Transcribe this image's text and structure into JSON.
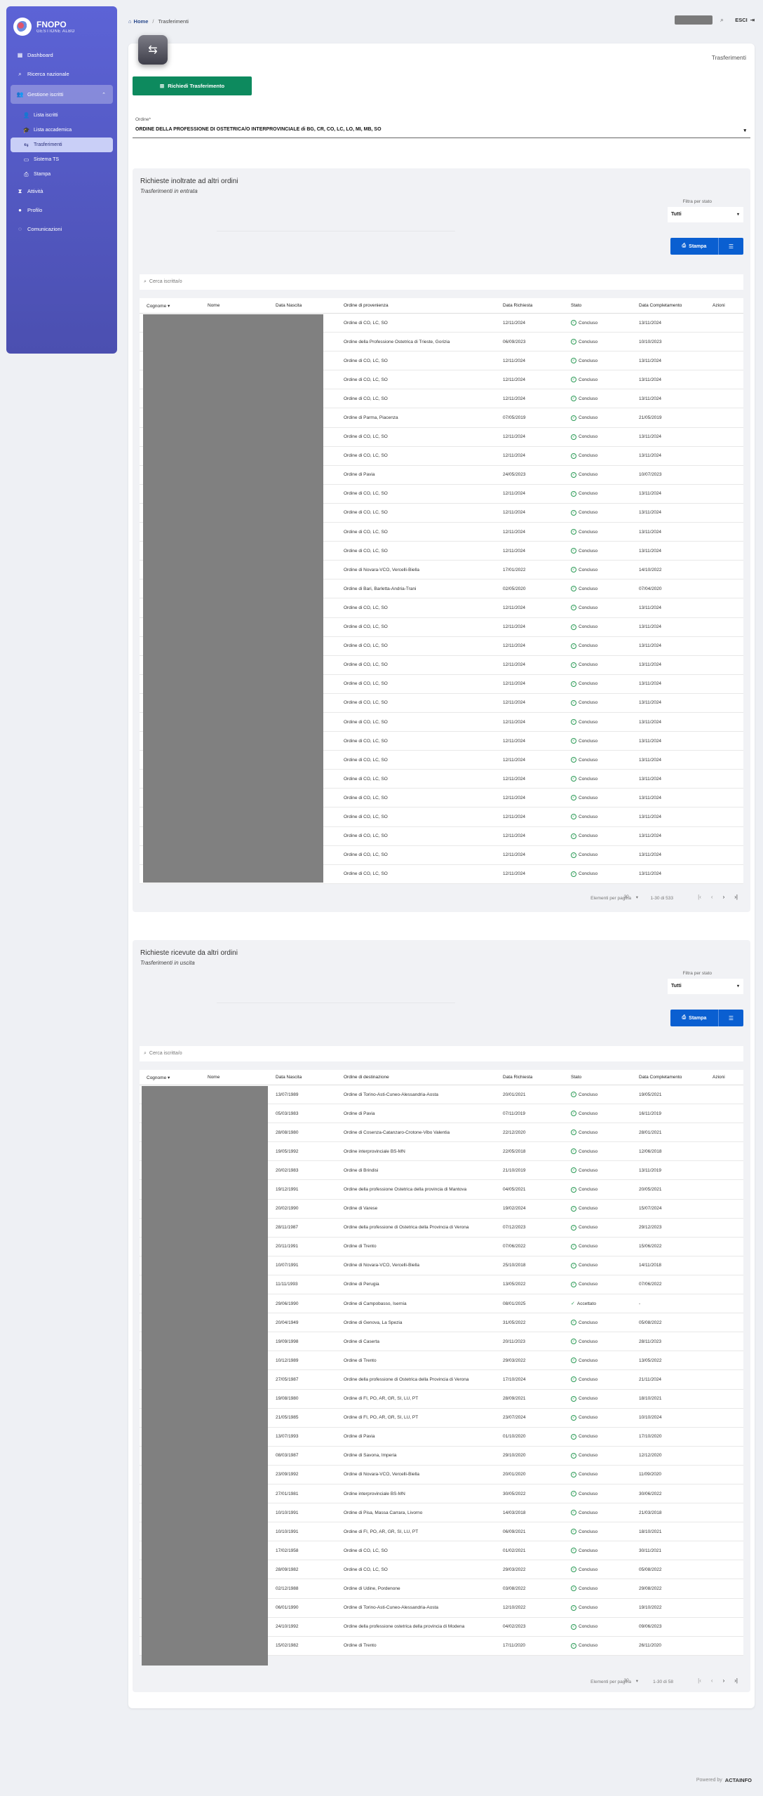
{
  "brand": {
    "title": "FNOPO",
    "subtitle": "GESTIONE ALBO"
  },
  "nav": {
    "dashboard": "Dashboard",
    "ricerca": "Ricerca nazionale",
    "gestione": "Gestione iscritti",
    "sub": [
      "Lista iscritti",
      "Lista accademica",
      "Trasferimenti",
      "Sistema TS",
      "Stampa"
    ],
    "attivita": "Attività",
    "profilo": "Profilo",
    "comunicazioni": "Comunicazioni"
  },
  "breadcrumb": {
    "home": "Home",
    "current": "Trasferimenti"
  },
  "header": {
    "logout": "ESCI"
  },
  "page": {
    "title": "Trasferimenti",
    "request_button": "Richiedi Trasferimento",
    "ordine_label": "Ordine*",
    "ordine_value": "ORDINE DELLA PROFESSIONE DI OSTETRICA/O INTERPROVINCIALE di BG, CR, CO, LC, LO, MI, MB, SO"
  },
  "columns_in": [
    "Cognome",
    "Nome",
    "Data Nascita",
    "Ordine di provenienza",
    "Data Richiesta",
    "Stato",
    "Data Completamento",
    "Azioni"
  ],
  "columns_out": [
    "Cognome",
    "Nome",
    "Data Nascita",
    "Ordine di destinazione",
    "Data Richiesta",
    "Stato",
    "Data Completamento",
    "Azioni"
  ],
  "section_in": {
    "title": "Richieste inoltrate ad altri ordini",
    "subtitle": "Trasferimenti in entrata",
    "filter_label": "Filtra per stato",
    "filter_value": "Tutti",
    "print": "Stampa",
    "search_placeholder": "Cerca iscritta/o",
    "per_page_label": "Elementi per pagina",
    "per_page": "30",
    "range": "1-30 di 533",
    "rows": [
      [
        "",
        "",
        "",
        "Ordine di CO, LC, SO",
        "12/11/2024",
        "Concluso",
        "13/11/2024"
      ],
      [
        "",
        "",
        "",
        "Ordine della Professione Ostetrica di Trieste, Gorizia",
        "06/09/2023",
        "Concluso",
        "10/10/2023"
      ],
      [
        "",
        "",
        "",
        "Ordine di CO, LC, SO",
        "12/11/2024",
        "Concluso",
        "13/11/2024"
      ],
      [
        "",
        "",
        "",
        "Ordine di CO, LC, SO",
        "12/11/2024",
        "Concluso",
        "13/11/2024"
      ],
      [
        "",
        "",
        "",
        "Ordine di CO, LC, SO",
        "12/11/2024",
        "Concluso",
        "13/11/2024"
      ],
      [
        "",
        "",
        "",
        "Ordine di Parma, Piacenza",
        "07/05/2019",
        "Concluso",
        "21/05/2019"
      ],
      [
        "",
        "",
        "",
        "Ordine di CO, LC, SO",
        "12/11/2024",
        "Concluso",
        "13/11/2024"
      ],
      [
        "",
        "",
        "",
        "Ordine di CO, LC, SO",
        "12/11/2024",
        "Concluso",
        "13/11/2024"
      ],
      [
        "",
        "",
        "",
        "Ordine di Pavia",
        "24/05/2023",
        "Concluso",
        "10/07/2023"
      ],
      [
        "",
        "",
        "",
        "Ordine di CO, LC, SO",
        "12/11/2024",
        "Concluso",
        "13/11/2024"
      ],
      [
        "",
        "",
        "",
        "Ordine di CO, LC, SO",
        "12/11/2024",
        "Concluso",
        "13/11/2024"
      ],
      [
        "",
        "",
        "",
        "Ordine di CO, LC, SO",
        "12/11/2024",
        "Concluso",
        "13/11/2024"
      ],
      [
        "",
        "",
        "",
        "Ordine di CO, LC, SO",
        "12/11/2024",
        "Concluso",
        "13/11/2024"
      ],
      [
        "",
        "",
        "",
        "Ordine di Novara-VCO, Vercelli-Biella",
        "17/01/2022",
        "Concluso",
        "14/10/2022"
      ],
      [
        "",
        "",
        "",
        "Ordine di Bari, Barletta-Andria-Trani",
        "02/05/2020",
        "Concluso",
        "07/04/2020"
      ],
      [
        "",
        "",
        "",
        "Ordine di CO, LC, SO",
        "12/11/2024",
        "Concluso",
        "13/11/2024"
      ],
      [
        "",
        "",
        "",
        "Ordine di CO, LC, SO",
        "12/11/2024",
        "Concluso",
        "13/11/2024"
      ],
      [
        "",
        "",
        "",
        "Ordine di CO, LC, SO",
        "12/11/2024",
        "Concluso",
        "13/11/2024"
      ],
      [
        "",
        "",
        "",
        "Ordine di CO, LC, SO",
        "12/11/2024",
        "Concluso",
        "13/11/2024"
      ],
      [
        "",
        "",
        "",
        "Ordine di CO, LC, SO",
        "12/11/2024",
        "Concluso",
        "13/11/2024"
      ],
      [
        "",
        "",
        "",
        "Ordine di CO, LC, SO",
        "12/11/2024",
        "Concluso",
        "13/11/2024"
      ],
      [
        "",
        "",
        "",
        "Ordine di CO, LC, SO",
        "12/11/2024",
        "Concluso",
        "13/11/2024"
      ],
      [
        "",
        "",
        "",
        "Ordine di CO, LC, SO",
        "12/11/2024",
        "Concluso",
        "13/11/2024"
      ],
      [
        "",
        "",
        "",
        "Ordine di CO, LC, SO",
        "12/11/2024",
        "Concluso",
        "13/11/2024"
      ],
      [
        "",
        "",
        "",
        "Ordine di CO, LC, SO",
        "12/11/2024",
        "Concluso",
        "13/11/2024"
      ],
      [
        "",
        "",
        "",
        "Ordine di CO, LC, SO",
        "12/11/2024",
        "Concluso",
        "13/11/2024"
      ],
      [
        "",
        "",
        "",
        "Ordine di CO, LC, SO",
        "12/11/2024",
        "Concluso",
        "13/11/2024"
      ],
      [
        "",
        "",
        "",
        "Ordine di CO, LC, SO",
        "12/11/2024",
        "Concluso",
        "13/11/2024"
      ],
      [
        "",
        "",
        "",
        "Ordine di CO, LC, SO",
        "12/11/2024",
        "Concluso",
        "13/11/2024"
      ],
      [
        "",
        "",
        "",
        "Ordine di CO, LC, SO",
        "12/11/2024",
        "Concluso",
        "13/11/2024"
      ]
    ]
  },
  "section_out": {
    "title": "Richieste ricevute da altri ordini",
    "subtitle": "Trasferimenti in uscita",
    "filter_label": "Filtra per stato",
    "filter_value": "Tutti",
    "print": "Stampa",
    "search_placeholder": "Cerca iscritta/o",
    "per_page_label": "Elementi per pagina",
    "per_page": "30",
    "range": "1-30 di 58",
    "rows": [
      [
        "",
        "",
        "13/07/1989",
        "Ordine di Torino-Asti-Cuneo-Alessandria-Aosta",
        "20/01/2021",
        "Concluso",
        "19/05/2021"
      ],
      [
        "",
        "",
        "05/03/1983",
        "Ordine di Pavia",
        "07/11/2019",
        "Concluso",
        "16/11/2019"
      ],
      [
        "",
        "",
        "28/08/1980",
        "Ordine di Cosenza-Catanzaro-Crotone-Vibo Valentia",
        "22/12/2020",
        "Concluso",
        "28/01/2021"
      ],
      [
        "",
        "",
        "19/05/1992",
        "Ordine interprovinciale BS-MN",
        "22/05/2018",
        "Concluso",
        "12/06/2018"
      ],
      [
        "",
        "",
        "20/02/1983",
        "Ordine di Brindisi",
        "21/10/2019",
        "Concluso",
        "13/11/2019"
      ],
      [
        "",
        "",
        "19/12/1991",
        "Ordine della professione Ostetrica della provincia di Mantova",
        "04/05/2021",
        "Concluso",
        "20/05/2021"
      ],
      [
        "",
        "",
        "20/02/1990",
        "Ordine di Varese",
        "19/02/2024",
        "Concluso",
        "15/07/2024"
      ],
      [
        "",
        "",
        "28/11/1987",
        "Ordine della professione di Ostetrica della Provincia di Verona",
        "07/12/2023",
        "Concluso",
        "29/12/2023"
      ],
      [
        "",
        "",
        "20/11/1991",
        "Ordine di Trento",
        "07/06/2022",
        "Concluso",
        "15/06/2022"
      ],
      [
        "",
        "",
        "10/07/1991",
        "Ordine di Novara-VCO, Vercelli-Biella",
        "25/10/2018",
        "Concluso",
        "14/11/2018"
      ],
      [
        "",
        "",
        "11/11/1993",
        "Ordine di Perugia",
        "13/05/2022",
        "Concluso",
        "07/06/2022"
      ],
      [
        "",
        "",
        "29/06/1990",
        "Ordine di Campobasso, Isernia",
        "08/01/2025",
        "Accettato",
        "-"
      ],
      [
        "",
        "",
        "20/04/1949",
        "Ordine di Genova, La Spezia",
        "31/05/2022",
        "Concluso",
        "05/08/2022"
      ],
      [
        "",
        "",
        "19/09/1998",
        "Ordine di Caserta",
        "20/11/2023",
        "Concluso",
        "28/11/2023"
      ],
      [
        "",
        "",
        "10/12/1989",
        "Ordine di Trento",
        "29/03/2022",
        "Concluso",
        "13/05/2022"
      ],
      [
        "",
        "",
        "27/05/1987",
        "Ordine della professione di Ostetrica della Provincia di Verona",
        "17/10/2024",
        "Concluso",
        "21/11/2024"
      ],
      [
        "",
        "",
        "19/08/1980",
        "Ordine di FI, PO, AR, GR, SI, LU, PT",
        "28/09/2021",
        "Concluso",
        "18/10/2021"
      ],
      [
        "",
        "",
        "21/05/1985",
        "Ordine di FI, PO, AR, GR, SI, LU, PT",
        "23/07/2024",
        "Concluso",
        "10/10/2024"
      ],
      [
        "",
        "",
        "13/07/1993",
        "Ordine di Pavia",
        "01/10/2020",
        "Concluso",
        "17/10/2020"
      ],
      [
        "",
        "",
        "08/03/1987",
        "Ordine di Savona, Imperia",
        "29/10/2020",
        "Concluso",
        "12/12/2020"
      ],
      [
        "",
        "",
        "23/09/1992",
        "Ordine di Novara-VCO, Vercelli-Biella",
        "20/01/2020",
        "Concluso",
        "11/09/2020"
      ],
      [
        "",
        "",
        "27/01/1981",
        "Ordine interprovinciale BS-MN",
        "30/05/2022",
        "Concluso",
        "30/06/2022"
      ],
      [
        "",
        "",
        "10/10/1991",
        "Ordine di Pisa, Massa Carrara, Livorno",
        "14/03/2018",
        "Concluso",
        "21/03/2018"
      ],
      [
        "",
        "",
        "10/10/1991",
        "Ordine di FI, PO, AR, GR, SI, LU, PT",
        "06/09/2021",
        "Concluso",
        "18/10/2021"
      ],
      [
        "",
        "",
        "17/02/1958",
        "Ordine di CO, LC, SO",
        "01/02/2021",
        "Concluso",
        "30/11/2021"
      ],
      [
        "",
        "",
        "28/09/1982",
        "Ordine di CO, LC, SO",
        "29/03/2022",
        "Concluso",
        "05/08/2022"
      ],
      [
        "",
        "",
        "02/12/1988",
        "Ordine di Udine, Pordenone",
        "03/08/2022",
        "Concluso",
        "29/08/2022"
      ],
      [
        "",
        "",
        "06/01/1990",
        "Ordine di Torino-Asti-Cuneo-Alessandria-Aosta",
        "12/10/2022",
        "Concluso",
        "19/10/2022"
      ],
      [
        "",
        "",
        "24/10/1992",
        "Ordine della professione ostetrica della provincia di Modena",
        "04/02/2023",
        "Concluso",
        "09/06/2023"
      ],
      [
        "",
        "",
        "15/02/1982",
        "Ordine di Trento",
        "17/11/2020",
        "Concluso",
        "26/11/2020"
      ]
    ]
  },
  "footer": {
    "powered": "Powered by",
    "brand": "ACTAINFO"
  },
  "colors": {
    "sidebar": "#5c63d6",
    "green": "#0d8a5e",
    "blue": "#0a5fd1",
    "ok": "#2a9a55"
  }
}
